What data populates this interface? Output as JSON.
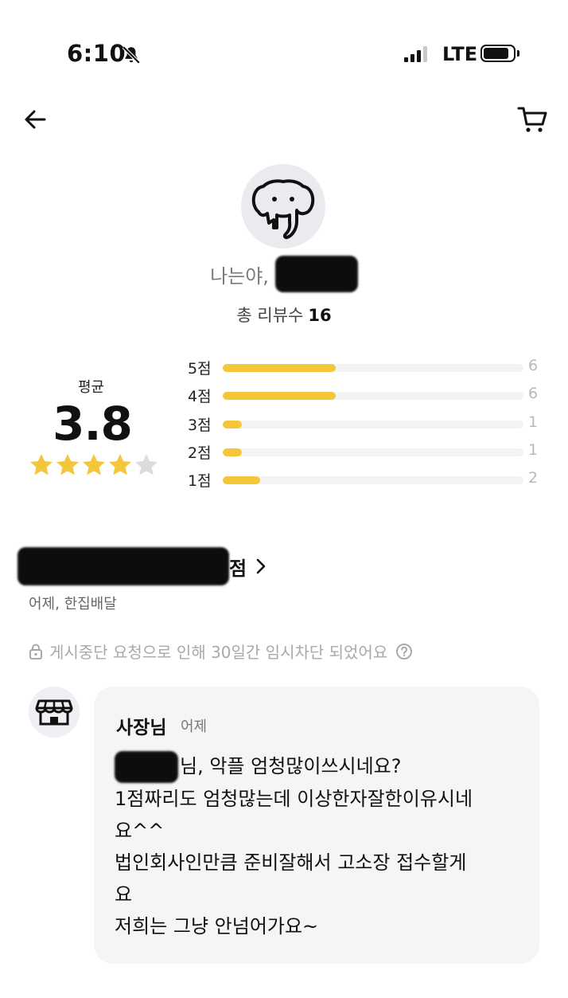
{
  "status_bar": {
    "time": "6:10",
    "network": "LTE",
    "bell_icon": "bell-slash-icon",
    "signal_icon": "signal-icon",
    "battery_icon": "battery-icon"
  },
  "nav": {
    "back_icon": "arrow-left-icon",
    "cart_icon": "cart-icon"
  },
  "profile": {
    "avatar_icon": "elephant-icon",
    "nickname_visible": "나는야,",
    "total_reviews_label": "총 리뷰수",
    "total_reviews_count": "16"
  },
  "rating_summary": {
    "average_label": "평균",
    "average_value": "3.8",
    "stars_filled": 4,
    "stars_total": 5,
    "star_color": "#F4C73A",
    "rows": [
      {
        "label": "5점",
        "count": "6",
        "fraction": 0.375
      },
      {
        "label": "4점",
        "count": "6",
        "fraction": 0.375
      },
      {
        "label": "3점",
        "count": "1",
        "fraction": 0.0625
      },
      {
        "label": "2점",
        "count": "1",
        "fraction": 0.0625
      },
      {
        "label": "1점",
        "count": "2",
        "fraction": 0.125
      }
    ]
  },
  "review": {
    "store_name_visible": "점",
    "chevron_icon": "chevron-right-icon",
    "meta": "어제, 한집배달",
    "lock_icon": "lock-icon",
    "notice": "게시중단 요청으로 인해 30일간 임시차단 되었어요",
    "help_icon": "question-circle-icon"
  },
  "owner_reply": {
    "avatar_icon": "storefront-icon",
    "name": "사장님",
    "time": "어제",
    "lines": [
      "님, 악플 엄청많이쓰시네요?",
      "1점짜리도 엄청많는데 이상한자잘한이유시네",
      "요^^",
      "법인회사인만큼 준비잘해서 고소장 접수할게",
      "요",
      "저희는 그냥 안넘어가요~"
    ]
  }
}
